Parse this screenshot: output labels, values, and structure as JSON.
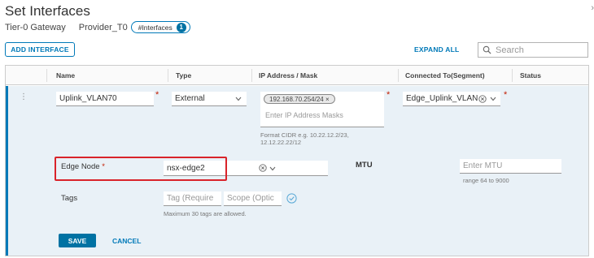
{
  "header": {
    "title": "Set Interfaces",
    "gateway_type": "Tier-0 Gateway",
    "gateway_name": "Provider_T0",
    "pill_label": "#Interfaces",
    "pill_count": "1"
  },
  "toolbar": {
    "add_interface": "ADD INTERFACE",
    "expand_all": "EXPAND ALL",
    "search_placeholder": "Search"
  },
  "columns": [
    "Name",
    "Type",
    "IP Address / Mask",
    "Connected To(Segment)",
    "Status"
  ],
  "row": {
    "name": "Uplink_VLAN70",
    "type": "External",
    "ip_chip": "192.168.70.254/24 ×",
    "ip_placeholder": "Enter IP Address Masks",
    "ip_hint_line1": "Format CIDR e.g. 10.22.12.2/23,",
    "ip_hint_line2": "12.12.22.22/12",
    "segment": "Edge_Uplink_VLAN",
    "edge_node_label": "Edge Node",
    "edge_node_value": "nsx-edge2",
    "mtu_label": "MTU",
    "mtu_placeholder": "Enter MTU",
    "mtu_hint": "range 64 to 9000",
    "tags_label": "Tags",
    "tag_placeholder": "Tag (Require",
    "scope_placeholder": "Scope (Optic",
    "tags_hint": "Maximum 30 tags are allowed.",
    "required_mark": "*",
    "save": "SAVE",
    "cancel": "CANCEL"
  },
  "colors": {
    "accent": "#0079b8",
    "row_bg": "#e9f1f7",
    "highlight": "#d9232a",
    "required": "#c21d00"
  }
}
